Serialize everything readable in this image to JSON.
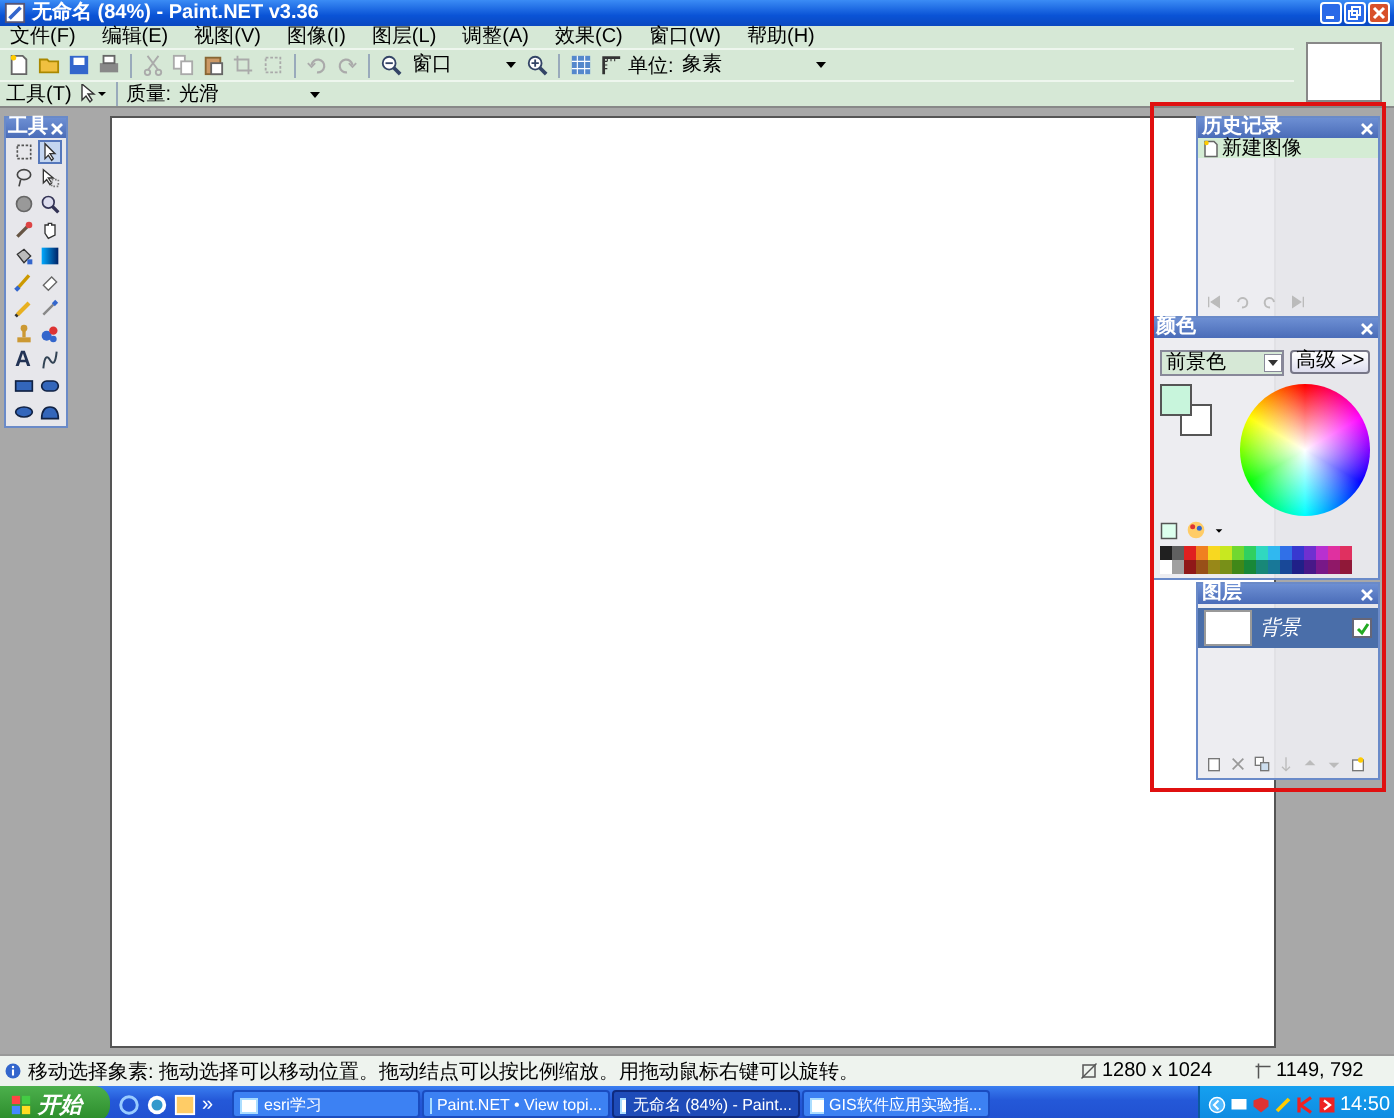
{
  "window": {
    "title": "无命名 (84%) - Paint.NET v3.36"
  },
  "menu": [
    "文件(F)",
    "编辑(E)",
    "视图(V)",
    "图像(I)",
    "图层(L)",
    "调整(A)",
    "效果(C)",
    "窗口(W)",
    "帮助(H)"
  ],
  "toolbar": {
    "zoom": "窗口",
    "units_label": "单位:",
    "units": "象素"
  },
  "tool_options": {
    "tool_label": "工具(T)",
    "quality_label": "质量:",
    "quality": "光滑"
  },
  "tools_panel": {
    "title": "工具",
    "tools": [
      {
        "selected": false
      },
      {
        "selected": true
      },
      {
        "selected": false
      },
      {
        "selected": false
      },
      {
        "selected": false
      },
      {
        "selected": false
      },
      {
        "selected": false
      },
      {
        "selected": false
      },
      {
        "selected": false
      },
      {
        "selected": false
      },
      {
        "selected": false
      },
      {
        "selected": false
      },
      {
        "selected": false
      },
      {
        "selected": false
      },
      {
        "selected": false
      },
      {
        "selected": false
      },
      {
        "selected": false,
        "glyph": "A"
      },
      {
        "selected": false
      },
      {
        "selected": false
      },
      {
        "selected": false
      },
      {
        "selected": false
      },
      {
        "selected": false
      }
    ]
  },
  "history_panel": {
    "title": "历史记录",
    "items": [
      {
        "label": "新建图像",
        "selected": true
      }
    ]
  },
  "colors_panel": {
    "title": "颜色",
    "mode": "前景色",
    "more_button": "高级 >>",
    "primary": {
      "color": "#c8f5dc"
    },
    "secondary": {
      "color": "#ffffff"
    },
    "palette": [
      {
        "color": "#202020"
      },
      {
        "color": "#606060"
      },
      {
        "color": "#e02020"
      },
      {
        "color": "#f08020"
      },
      {
        "color": "#f8d820"
      },
      {
        "color": "#c8e820"
      },
      {
        "color": "#70d830"
      },
      {
        "color": "#30d060"
      },
      {
        "color": "#30d8c0"
      },
      {
        "color": "#30b8f0"
      },
      {
        "color": "#3070e8"
      },
      {
        "color": "#3838d0"
      },
      {
        "color": "#7030d0"
      },
      {
        "color": "#b830d0"
      },
      {
        "color": "#e030a0"
      },
      {
        "color": "#e03060"
      },
      {
        "color": "#ffffff"
      },
      {
        "color": "#a0a0a0"
      },
      {
        "color": "#901818"
      },
      {
        "color": "#985018"
      },
      {
        "color": "#988818"
      },
      {
        "color": "#789018"
      },
      {
        "color": "#408818"
      },
      {
        "color": "#188838"
      },
      {
        "color": "#188878"
      },
      {
        "color": "#187898"
      },
      {
        "color": "#184898"
      },
      {
        "color": "#202088"
      },
      {
        "color": "#481888"
      },
      {
        "color": "#781888"
      },
      {
        "color": "#901868"
      },
      {
        "color": "#901838"
      }
    ]
  },
  "layers_panel": {
    "title": "图层",
    "layers": [
      {
        "name": "背景",
        "visible": true,
        "selected": true
      }
    ]
  },
  "status_bar": {
    "hint": "移动选择象素: 拖动选择可以移动位置。拖动结点可以按比例缩放。用拖动鼠标右键可以旋转。",
    "image_size": "1280 x 1024",
    "cursor": "1149, 792"
  },
  "taskbar": {
    "start": "开始",
    "more": "»",
    "tasks": [
      {
        "label": "esri学习",
        "selected": false
      },
      {
        "label": "Paint.NET • View topi...",
        "selected": false
      },
      {
        "label": "无命名 (84%) - Paint...",
        "selected": true
      },
      {
        "label": "GIS软件应用实验指...",
        "selected": false
      }
    ],
    "clock": "14:50"
  }
}
